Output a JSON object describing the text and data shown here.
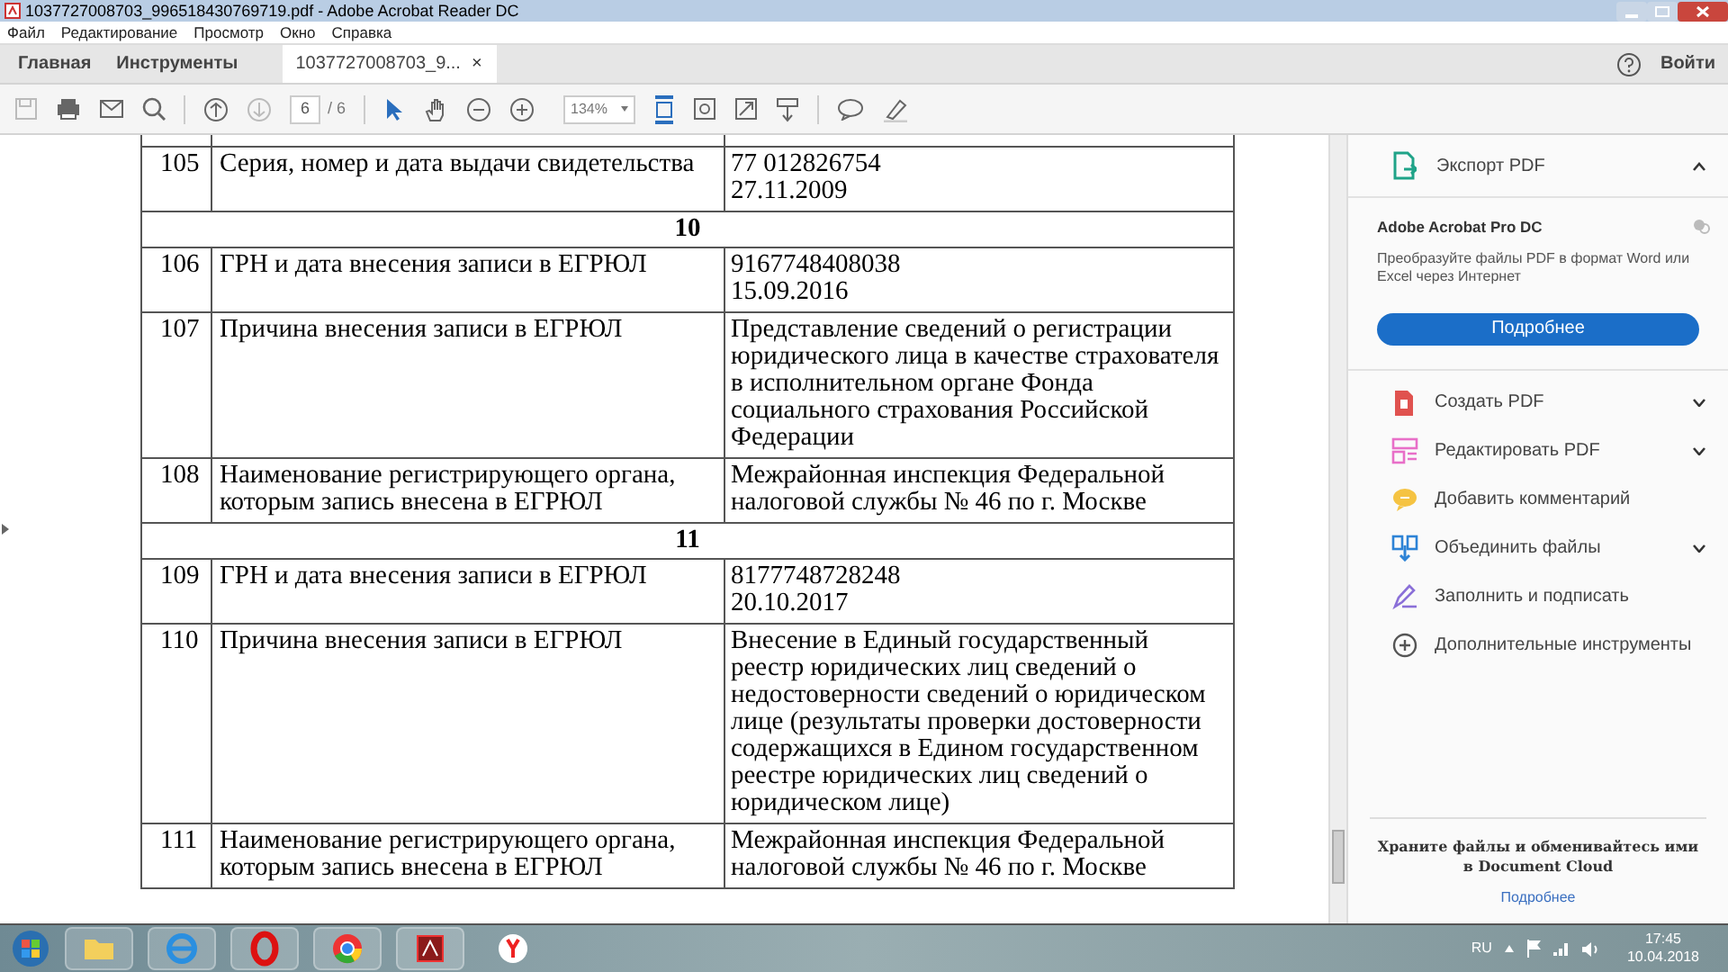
{
  "window": {
    "title": "1037727008703_996518430769719.pdf - Adobe Acrobat Reader DC"
  },
  "menu": [
    "Файл",
    "Редактирование",
    "Просмотр",
    "Окно",
    "Справка"
  ],
  "tabs": [
    {
      "label": "Главная",
      "selected": false
    },
    {
      "label": "Инструменты",
      "selected": false
    },
    {
      "label": "1037727008703_9...",
      "selected": true,
      "close": "×"
    }
  ],
  "sign_in": "Войти",
  "toolbar": {
    "page": "6",
    "page_total": "/ 6",
    "zoom": "134%"
  },
  "table": {
    "rows": [
      {
        "kind": "row",
        "number": "105",
        "label": "Серия, номер и дата выдачи свидетельства",
        "value": "77 012826754\n27.11.2009"
      },
      {
        "kind": "section",
        "label": "10"
      },
      {
        "kind": "row",
        "number": "106",
        "label": "ГРН и дата внесения записи в ЕГРЮЛ",
        "value": "9167748408038\n15.09.2016"
      },
      {
        "kind": "row",
        "number": "107",
        "label": "Причина внесения записи в ЕГРЮЛ",
        "value": "Представление сведений о регистрации юридического лица в качестве страхователя в исполнительном органе Фонда социального страхования Российской Федерации"
      },
      {
        "kind": "row",
        "number": "108",
        "label": "Наименование регистрирующего органа, которым запись внесена в ЕГРЮЛ",
        "value": "Межрайонная инспекция Федеральной налоговой службы № 46 по г. Москве"
      },
      {
        "kind": "section",
        "label": "11"
      },
      {
        "kind": "row",
        "number": "109",
        "label": "ГРН и дата внесения записи в ЕГРЮЛ",
        "value": "8177748728248\n20.10.2017"
      },
      {
        "kind": "row",
        "number": "110",
        "label": "Причина внесения записи в ЕГРЮЛ",
        "value": "Внесение в Единый государственный реестр юридических лиц сведений о недостоверности сведений о юридическом лице (результаты проверки достоверности содержащихся в Едином государственном реестре юридических лиц сведений о юридическом лице)"
      },
      {
        "kind": "row",
        "number": "111",
        "label": "Наименование регистрирующего органа, которым запись внесена в ЕГРЮЛ",
        "value": "Межрайонная инспекция Федеральной налоговой службы № 46 по г. Москве"
      }
    ]
  },
  "right_pane": {
    "export": {
      "label": "Экспорт PDF",
      "expanded": true
    },
    "promo": {
      "title": "Adobe Acrobat Pro DC",
      "text": "Преобразуйте файлы PDF в формат Word или Excel через Интернет",
      "button": "Подробнее"
    },
    "tools": [
      {
        "label": "Создать PDF",
        "expandable": true,
        "color": "#e0524f"
      },
      {
        "label": "Редактировать PDF",
        "expandable": true,
        "color": "#e86fc8"
      },
      {
        "label": "Добавить комментарий",
        "expandable": false,
        "color": "#f5c342"
      },
      {
        "label": "Объединить файлы",
        "expandable": true,
        "color": "#2d83d6"
      },
      {
        "label": "Заполнить и подписать",
        "expandable": false,
        "color": "#8a6fd8"
      },
      {
        "label": "Дополнительные инструменты",
        "expandable": false,
        "color": "#555555"
      }
    ],
    "cloud": {
      "text": "Храните файлы и обменивайтесь ими в Document Cloud",
      "link": "Подробнее"
    }
  },
  "taskbar": {
    "language": "RU",
    "time": "17:45",
    "date": "10.04.2018"
  }
}
